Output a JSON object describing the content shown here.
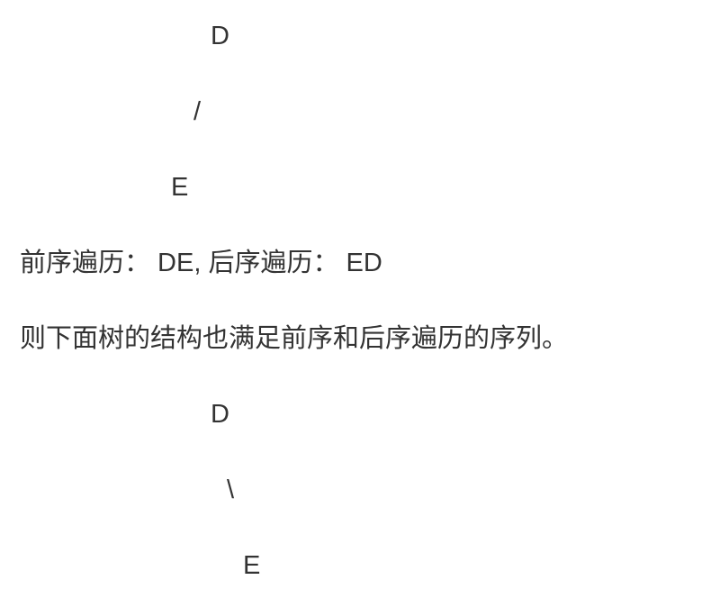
{
  "tree1": {
    "root": "D",
    "edge": "/",
    "child": "E"
  },
  "traversal_line": "前序遍历： DE, 后序遍历： ED",
  "description": "则下面树的结构也满足前序和后序遍历的序列。",
  "tree2": {
    "root": "D",
    "edge": "\\",
    "child": "E"
  }
}
